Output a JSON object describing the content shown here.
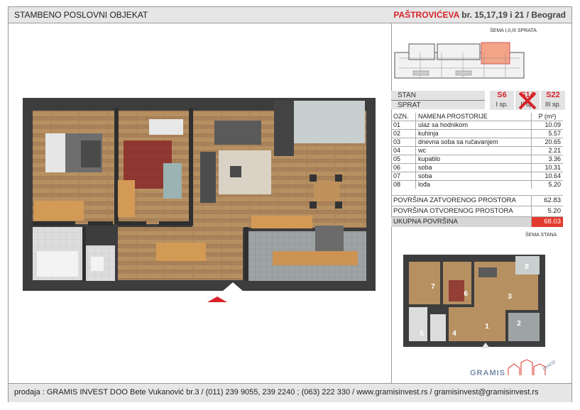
{
  "header": {
    "left_title": "STAMBENO POSLOVNI OBJEKAT",
    "right_street": "PAŠTROVIĆEVA",
    "right_address": "br. 15,17,19 i 21 / Beograd"
  },
  "floor_scheme_label": "ŠEMA I,II,III SPRATA",
  "apartment_selector": {
    "stan_label": "STAN",
    "sprat_label": "SPRAT",
    "floors": [
      {
        "num": "S6",
        "floor": "I sp.",
        "crossed": false
      },
      {
        "num": "S14",
        "floor": "II sp.",
        "crossed": true
      },
      {
        "num": "S22",
        "floor": "III sp.",
        "crossed": false
      }
    ]
  },
  "rooms_table": {
    "headers": {
      "ozn": "OZN.",
      "name": "NAMENA PROSTORIJE",
      "area": "P (m²)"
    },
    "rows": [
      {
        "ozn": "01",
        "name": "ulaz sa hodnikom",
        "area": "10.09"
      },
      {
        "ozn": "02",
        "name": "kuhinja",
        "area": "5.57"
      },
      {
        "ozn": "03",
        "name": "dnevna soba sa ručavanjem",
        "area": "20.65"
      },
      {
        "ozn": "04",
        "name": "wc",
        "area": "2.21"
      },
      {
        "ozn": "05",
        "name": "kupatilo",
        "area": "3.36"
      },
      {
        "ozn": "06",
        "name": "soba",
        "area": "10.31"
      },
      {
        "ozn": "07",
        "name": "soba",
        "area": "10.64"
      },
      {
        "ozn": "08",
        "name": "lođa",
        "area": "5.20"
      }
    ]
  },
  "totals": {
    "closed_label": "POVRŠINA ZATVORENOG PROSTORA",
    "closed_value": "62.83",
    "open_label": "POVRŠINA OTVORENOG PROSTORA",
    "open_value": "5.20",
    "total_label": "UKUPNA POVRŠINA",
    "total_value": "68.03"
  },
  "apartment_scheme_label": "ŠEMA STANA",
  "scheme_room_numbers": [
    "1",
    "2",
    "3",
    "4",
    "5",
    "6",
    "7",
    "8"
  ],
  "logo": {
    "brand": "GRAMIS",
    "word": "invest"
  },
  "footer": "prodaja : GRAMIS INVEST DOO Bete Vukanović br.3  /  (011) 239 9055, 239 2240 ; (063) 222 330  /  www.gramisinvest.rs  /  gramisinvest@gramisinvest.rs",
  "colors": {
    "accent_red": "#d8232a",
    "total_red": "#e33a2e",
    "header_gray": "#e6e6e6"
  }
}
